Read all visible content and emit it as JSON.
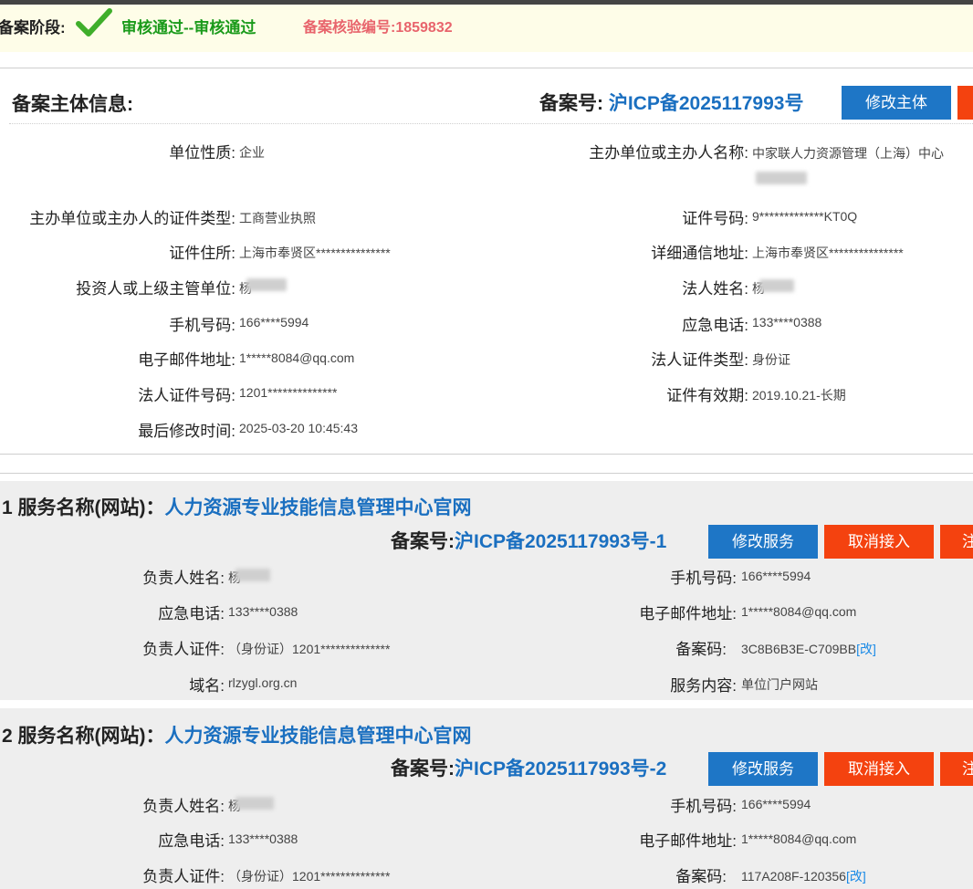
{
  "stage": {
    "label": "备案阶段:",
    "status": "审核通过--审核通过",
    "verify_code": "备案核验编号:1859832"
  },
  "subject": {
    "title": "备案主体信息:",
    "beian_label": "备案号: ",
    "beian_number": "沪ICP备2025117993号",
    "edit_button": "修改主体",
    "fields_left": [
      {
        "label": "单位性质:",
        "value": "企业"
      },
      {
        "label": "主办单位或主办人的证件类型:",
        "value": "工商营业执照"
      },
      {
        "label": "证件住所:",
        "value": "上海市奉贤区***************"
      },
      {
        "label": "投资人或上级主管单位:",
        "value": "杨"
      },
      {
        "label": "手机号码:",
        "value": "166****5994"
      },
      {
        "label": "电子邮件地址:",
        "value": "1*****8084@qq.com"
      },
      {
        "label": "法人证件号码:",
        "value": "1201**************"
      },
      {
        "label": "最后修改时间:",
        "value": "2025-03-20 10:45:43"
      }
    ],
    "fields_right": [
      {
        "label": "主办单位或主办人名称:",
        "value": "中家联人力资源管理（上海）中心"
      },
      {
        "label": "证件号码:",
        "value": "9*************KT0Q"
      },
      {
        "label": "详细通信地址:",
        "value": "上海市奉贤区***************"
      },
      {
        "label": "法人姓名:",
        "value": "杨"
      },
      {
        "label": "应急电话:",
        "value": "133****0388"
      },
      {
        "label": "法人证件类型:",
        "value": "身份证"
      },
      {
        "label": "证件有效期:",
        "value": "2019.10.21-长期"
      }
    ]
  },
  "services": [
    {
      "index": "1",
      "title_label": "服务名称(网站)：",
      "name": "人力资源专业技能信息管理中心官网",
      "beian_label": "备案号:",
      "beian_number": "沪ICP备2025117993号-1",
      "edit_button": "修改服务",
      "cancel_button": "取消接入",
      "extra_button": "注",
      "fields": {
        "contact_name": {
          "label": "负责人姓名:",
          "value": "杨"
        },
        "mobile": {
          "label": "手机号码:",
          "value": "166****5994"
        },
        "emergency": {
          "label": "应急电话:",
          "value": "133****0388"
        },
        "email": {
          "label": "电子邮件地址:",
          "value": "1*****8084@qq.com"
        },
        "cert": {
          "label": "负责人证件:",
          "value": "（身份证）1201**************"
        },
        "beian_code": {
          "label": "备案码:",
          "value": "3C8B6B3E-C709BB",
          "edit": "[改]"
        },
        "domain": {
          "label": "域名:",
          "value": "rlzygl.org.cn"
        },
        "content": {
          "label": "服务内容:",
          "value": "单位门户网站"
        }
      }
    },
    {
      "index": "2",
      "title_label": "服务名称(网站)：",
      "name": "人力资源专业技能信息管理中心官网",
      "beian_label": "备案号:",
      "beian_number": "沪ICP备2025117993号-2",
      "edit_button": "修改服务",
      "cancel_button": "取消接入",
      "extra_button": "注",
      "fields": {
        "contact_name": {
          "label": "负责人姓名:",
          "value": "杨"
        },
        "mobile": {
          "label": "手机号码:",
          "value": "166****5994"
        },
        "emergency": {
          "label": "应急电话:",
          "value": "133****0388"
        },
        "email": {
          "label": "电子邮件地址:",
          "value": "1*****8084@qq.com"
        },
        "cert": {
          "label": "负责人证件:",
          "value": "（身份证）1201**************"
        },
        "beian_code": {
          "label": "备案码:",
          "value": "117A208F-120356",
          "edit": "[改]"
        }
      }
    }
  ]
}
